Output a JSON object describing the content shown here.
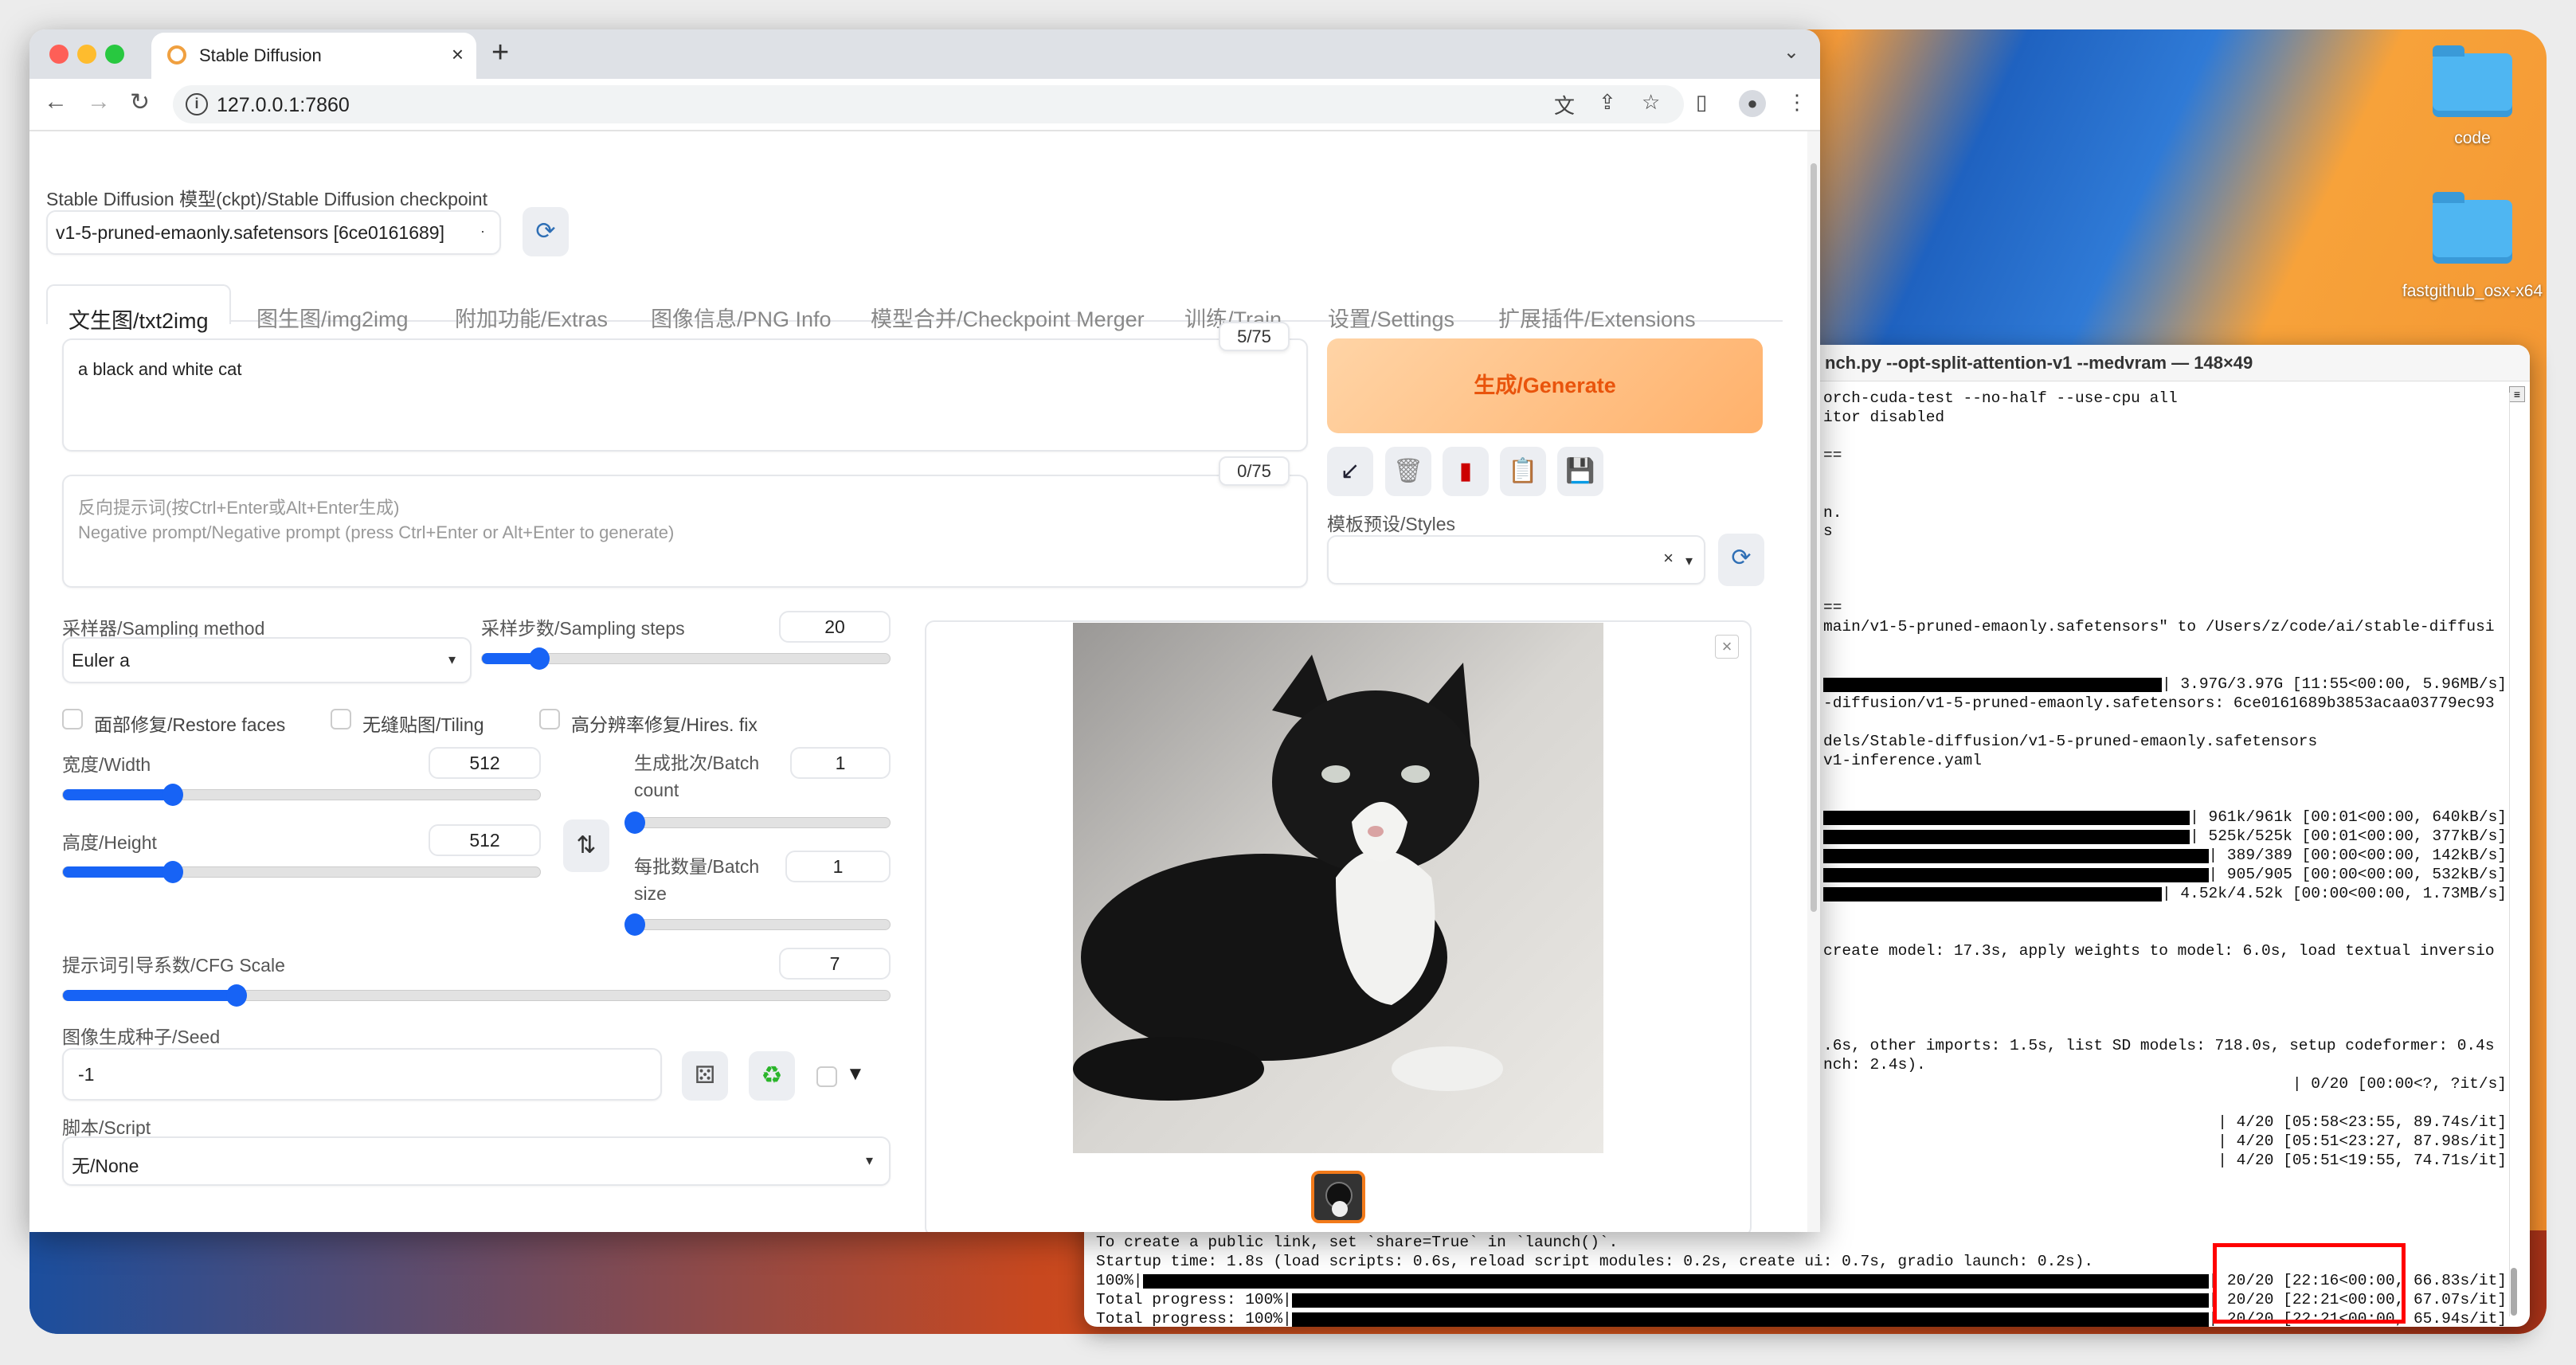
{
  "desktop": {
    "icons": [
      {
        "label": "code",
        "icon": "folder-icon"
      },
      {
        "label": "fastgithub_osx-x64",
        "icon": "folder-icon"
      }
    ],
    "wallpaper_colors": [
      "#1f6fd0",
      "#f07a22",
      "#e8532a"
    ]
  },
  "browser": {
    "tab_title": "Stable Diffusion",
    "url": "127.0.0.1:7860",
    "toolbar_icons": [
      "translate-icon",
      "share-icon",
      "star-icon",
      "sidebar-icon",
      "profile-icon",
      "menu-icon"
    ]
  },
  "app": {
    "checkpoint_label": "Stable Diffusion 模型(ckpt)/Stable Diffusion checkpoint",
    "checkpoint_value": "v1-5-pruned-emaonly.safetensors [6ce0161689]",
    "tabs": [
      "文生图/txt2img",
      "图生图/img2img",
      "附加功能/Extras",
      "图像信息/PNG Info",
      "模型合并/Checkpoint Merger",
      "训练/Train",
      "设置/Settings",
      "扩展插件/Extensions"
    ],
    "prompt": "a black and white cat",
    "prompt_count": "5/75",
    "negative_placeholder_1": "反向提示词(按Ctrl+Enter或Alt+Enter生成)",
    "negative_placeholder_2": "Negative prompt/Negative prompt (press Ctrl+Enter or Alt+Enter to generate)",
    "negative_count": "0/75",
    "generate_label": "生成/Generate",
    "accent_color": "#ff9a3c",
    "styles_label": "模板预设/Styles",
    "sampling_method_label": "采样器/Sampling method",
    "sampling_method_value": "Euler a",
    "sampling_steps_label": "采样步数/Sampling steps",
    "sampling_steps_value": "20",
    "sampling_steps_fill": 0.14,
    "restore_faces_label": "面部修复/Restore faces",
    "tiling_label": "无缝贴图/Tiling",
    "hires_label": "高分辨率修复/Hires. fix",
    "width_label": "宽度/Width",
    "width_value": "512",
    "width_fill": 0.23,
    "height_label": "高度/Height",
    "height_value": "512",
    "height_fill": 0.23,
    "batch_count_label": "生成批次/Batch count",
    "batch_count_value": "1",
    "batch_count_fill": 0,
    "batch_size_label": "每批数量/Batch size",
    "batch_size_value": "1",
    "batch_size_fill": 0,
    "cfg_label": "提示词引导系数/CFG Scale",
    "cfg_value": "7",
    "cfg_fill": 0.21,
    "seed_label": "图像生成种子/Seed",
    "seed_value": "-1",
    "script_label": "脚本/Script",
    "script_value": "无/None",
    "slider_color": "#1763f5"
  },
  "terminal": {
    "title": "nch.py --opt-split-attention-v1 --medvram — 148×49",
    "lines": [
      {
        "text": "orch-cuda-test --no-half --use-cpu all"
      },
      {
        "text": "itor disabled"
      },
      {
        "text": ""
      },
      {
        "text": "=="
      },
      {
        "text": ""
      },
      {
        "text": ""
      },
      {
        "text": "n."
      },
      {
        "text": "s"
      },
      {
        "text": ""
      },
      {
        "text": ""
      },
      {
        "text": ""
      },
      {
        "text": "=="
      },
      {
        "text": "main/v1-5-pruned-emaonly.safetensors\" to /Users/z/code/ai/stable-diffusi"
      },
      {
        "text": ""
      },
      {
        "text": ""
      },
      {
        "text": "| 3.97G/3.97G [11:55<00:00, 5.96MB/s]",
        "bar": true
      },
      {
        "text": "-diffusion/v1-5-pruned-emaonly.safetensors: 6ce0161689b3853acaa03779ec93"
      },
      {
        "text": ""
      },
      {
        "text": "dels/Stable-diffusion/v1-5-pruned-emaonly.safetensors"
      },
      {
        "text": "v1-inference.yaml"
      },
      {
        "text": ""
      },
      {
        "text": ""
      },
      {
        "text": "| 961k/961k [00:01<00:00, 640kB/s]",
        "bar": true
      },
      {
        "text": "| 525k/525k [00:01<00:00, 377kB/s]",
        "bar": true
      },
      {
        "text": "| 389/389 [00:00<00:00, 142kB/s]",
        "bar": true
      },
      {
        "text": "| 905/905 [00:00<00:00, 532kB/s]",
        "bar": true
      },
      {
        "text": "| 4.52k/4.52k [00:00<00:00, 1.73MB/s]",
        "bar": true
      },
      {
        "text": ""
      },
      {
        "text": ""
      },
      {
        "text": "create model: 17.3s, apply weights to model: 6.0s, load textual inversio"
      },
      {
        "text": ""
      },
      {
        "text": ""
      },
      {
        "text": ""
      },
      {
        "text": ""
      },
      {
        "text": ".6s, other imports: 1.5s, list SD models: 718.0s, setup codeformer: 0.4s"
      },
      {
        "text": "nch: 2.4s)."
      },
      {
        "text": "| 0/20 [00:00<?, ?it/s]",
        "right": true
      },
      {
        "text": ""
      },
      {
        "text": "| 4/20 [05:58<23:55, 89.74s/it]",
        "right": true
      },
      {
        "text": "| 4/20 [05:51<23:27, 87.98s/it]",
        "right": true
      },
      {
        "text": "| 4/20 [05:51<19:55, 74.71s/it]",
        "right": true
      }
    ],
    "bottom_lines": [
      {
        "text": "To create a public link, set `share=True` in `launch()`."
      },
      {
        "text": "Startup time: 1.8s (load scripts: 0.6s, reload script modules: 0.2s, create ui: 0.7s, gradio launch: 0.2s)."
      },
      {
        "prefix": "100%|",
        "text": "| 20/20 [22:16<00:00, 66.83s/it]",
        "bar": true
      },
      {
        "prefix": "Total progress: 100%|",
        "text": "| 20/20 [22:21<00:00, 67.07s/it]",
        "bar": true
      },
      {
        "prefix": "Total progress: 100%|",
        "text": "| 20/20 [22:21<00:00, 65.94s/it]",
        "bar": true
      }
    ],
    "highlight_color": "#ff0000"
  }
}
